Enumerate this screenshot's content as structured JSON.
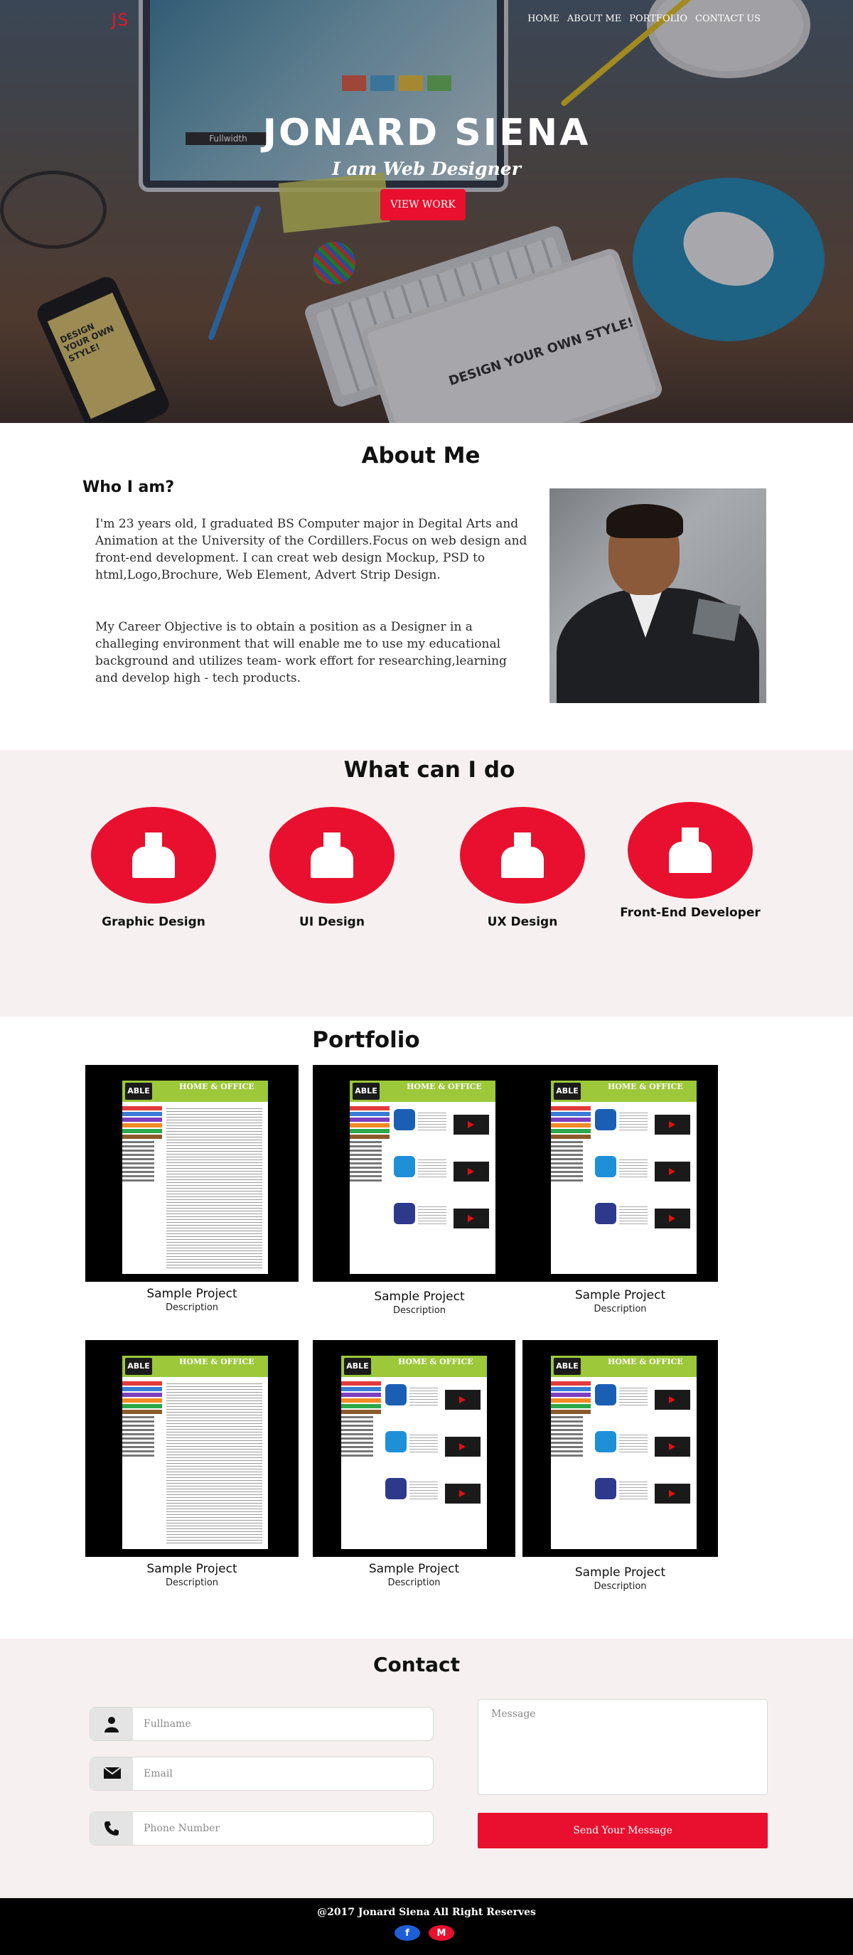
{
  "brand": {
    "logo": "JS"
  },
  "nav": {
    "items": [
      "HOME",
      "ABOUT ME",
      "PORTFOLIO",
      "CONTACT US"
    ]
  },
  "hero": {
    "name": "JONARD SIENA",
    "tagline": "I am Web Designer",
    "cta_label": "VIEW WORK",
    "tablet_text": "DESIGN YOUR OWN STYLE!",
    "phone_text": "DESIGN YOUR OWN STYLE!",
    "monitor_text": "Fullwidth"
  },
  "about": {
    "title": "About Me",
    "subtitle": "Who I am?",
    "paragraph_1": "I'm 23 years old, I graduated BS Computer major in Degital Arts and Animation at the University of the Cordillers.Focus on  web design and front-end development.  I can creat web design Mockup, PSD to html,Logo,Brochure, Web Element, Advert Strip Design.",
    "paragraph_2": "My Career Objective is to obtain a position as a  Designer in a challeging environment that will enable me to use my educational background and utilizes team- work effort for researching,learning and  develop high - tech products."
  },
  "skills": {
    "title": "What can I do",
    "items": [
      {
        "label": "Graphic Design",
        "icon": "user-icon"
      },
      {
        "label": "UI Design",
        "icon": "user-icon"
      },
      {
        "label": "UX Design",
        "icon": "user-icon"
      },
      {
        "label": "Front-End Developer",
        "icon": "user-icon"
      }
    ]
  },
  "portfolio": {
    "title": "Portfolio",
    "projects": [
      {
        "title": "Sample Project",
        "description": "Description",
        "variant": "article"
      },
      {
        "title": "Sample Project",
        "description": "Description",
        "variant": "cards"
      },
      {
        "title": "Sample Project",
        "description": "Description",
        "variant": "cards"
      },
      {
        "title": "Sample Project",
        "description": "Description",
        "variant": "article"
      },
      {
        "title": "Sample Project",
        "description": "Description",
        "variant": "cards"
      },
      {
        "title": "Sample Project",
        "description": "Description",
        "variant": "cards"
      }
    ],
    "thumb_brand": "ABLE",
    "thumb_heading": "HOME & OFFICE"
  },
  "contact": {
    "title": "Contact",
    "fullname_placeholder": "Fullname",
    "email_placeholder": "Email",
    "phone_placeholder": "Phone Number",
    "message_placeholder": "Message",
    "send_label": "Send Your Message"
  },
  "footer": {
    "copyright": "@2017 Jonard Siena All Right Reserves",
    "social": [
      {
        "name": "facebook",
        "icon": "facebook-icon",
        "glyph": "f"
      },
      {
        "name": "mail",
        "icon": "mail-icon",
        "glyph": "M"
      }
    ]
  },
  "colors": {
    "accent": "#e8102e",
    "section_alt_bg": "#f7f0f0",
    "footer_bg": "#000000",
    "thumb_header": "#9cc83a"
  }
}
